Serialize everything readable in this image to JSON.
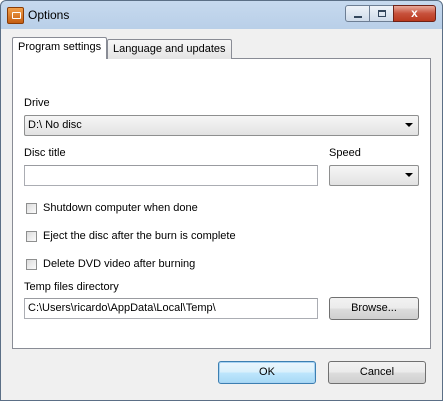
{
  "window": {
    "title": "Options",
    "close_glyph": "x"
  },
  "tabs": {
    "program_settings": "Program settings",
    "language_updates": "Language and updates"
  },
  "drive": {
    "label": "Drive",
    "value": "D:\\ No disc"
  },
  "disc_title": {
    "label": "Disc title",
    "value": ""
  },
  "speed": {
    "label": "Speed",
    "value": ""
  },
  "options": {
    "shutdown": "Shutdown computer when done",
    "eject": "Eject the disc after the burn is complete",
    "delete_video": "Delete DVD video after burning"
  },
  "temp_dir": {
    "label": "Temp files directory",
    "value": "C:\\Users\\ricardo\\AppData\\Local\\Temp\\",
    "browse": "Browse..."
  },
  "footer": {
    "ok": "OK",
    "cancel": "Cancel"
  }
}
